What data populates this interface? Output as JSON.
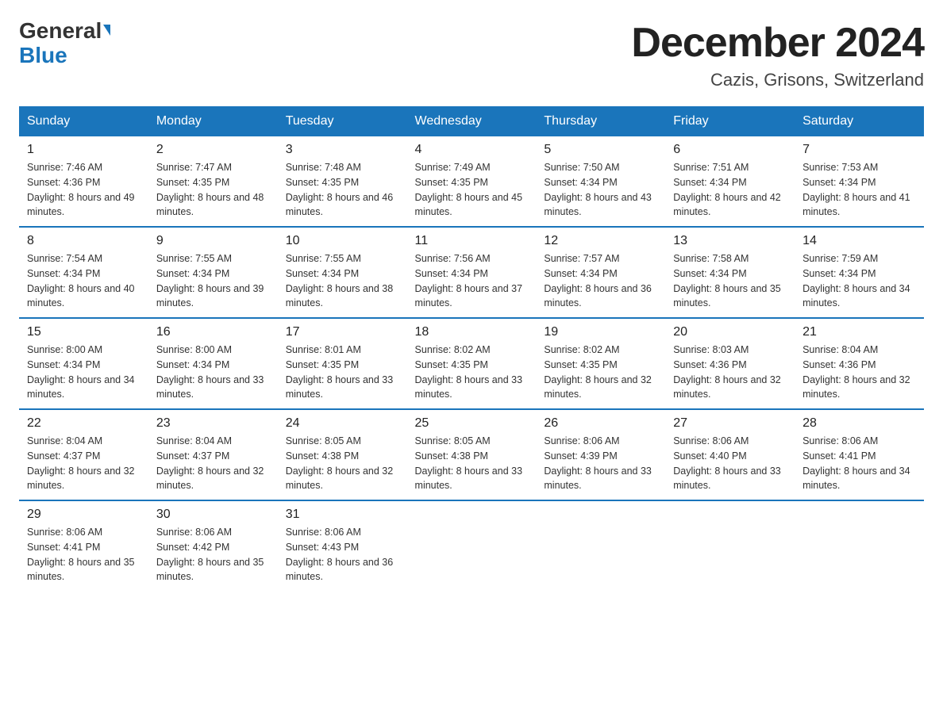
{
  "logo": {
    "general": "General",
    "blue": "Blue"
  },
  "header": {
    "month_year": "December 2024",
    "location": "Cazis, Grisons, Switzerland"
  },
  "days_of_week": [
    "Sunday",
    "Monday",
    "Tuesday",
    "Wednesday",
    "Thursday",
    "Friday",
    "Saturday"
  ],
  "weeks": [
    [
      {
        "day": "1",
        "sunrise": "7:46 AM",
        "sunset": "4:36 PM",
        "daylight": "8 hours and 49 minutes."
      },
      {
        "day": "2",
        "sunrise": "7:47 AM",
        "sunset": "4:35 PM",
        "daylight": "8 hours and 48 minutes."
      },
      {
        "day": "3",
        "sunrise": "7:48 AM",
        "sunset": "4:35 PM",
        "daylight": "8 hours and 46 minutes."
      },
      {
        "day": "4",
        "sunrise": "7:49 AM",
        "sunset": "4:35 PM",
        "daylight": "8 hours and 45 minutes."
      },
      {
        "day": "5",
        "sunrise": "7:50 AM",
        "sunset": "4:34 PM",
        "daylight": "8 hours and 43 minutes."
      },
      {
        "day": "6",
        "sunrise": "7:51 AM",
        "sunset": "4:34 PM",
        "daylight": "8 hours and 42 minutes."
      },
      {
        "day": "7",
        "sunrise": "7:53 AM",
        "sunset": "4:34 PM",
        "daylight": "8 hours and 41 minutes."
      }
    ],
    [
      {
        "day": "8",
        "sunrise": "7:54 AM",
        "sunset": "4:34 PM",
        "daylight": "8 hours and 40 minutes."
      },
      {
        "day": "9",
        "sunrise": "7:55 AM",
        "sunset": "4:34 PM",
        "daylight": "8 hours and 39 minutes."
      },
      {
        "day": "10",
        "sunrise": "7:55 AM",
        "sunset": "4:34 PM",
        "daylight": "8 hours and 38 minutes."
      },
      {
        "day": "11",
        "sunrise": "7:56 AM",
        "sunset": "4:34 PM",
        "daylight": "8 hours and 37 minutes."
      },
      {
        "day": "12",
        "sunrise": "7:57 AM",
        "sunset": "4:34 PM",
        "daylight": "8 hours and 36 minutes."
      },
      {
        "day": "13",
        "sunrise": "7:58 AM",
        "sunset": "4:34 PM",
        "daylight": "8 hours and 35 minutes."
      },
      {
        "day": "14",
        "sunrise": "7:59 AM",
        "sunset": "4:34 PM",
        "daylight": "8 hours and 34 minutes."
      }
    ],
    [
      {
        "day": "15",
        "sunrise": "8:00 AM",
        "sunset": "4:34 PM",
        "daylight": "8 hours and 34 minutes."
      },
      {
        "day": "16",
        "sunrise": "8:00 AM",
        "sunset": "4:34 PM",
        "daylight": "8 hours and 33 minutes."
      },
      {
        "day": "17",
        "sunrise": "8:01 AM",
        "sunset": "4:35 PM",
        "daylight": "8 hours and 33 minutes."
      },
      {
        "day": "18",
        "sunrise": "8:02 AM",
        "sunset": "4:35 PM",
        "daylight": "8 hours and 33 minutes."
      },
      {
        "day": "19",
        "sunrise": "8:02 AM",
        "sunset": "4:35 PM",
        "daylight": "8 hours and 32 minutes."
      },
      {
        "day": "20",
        "sunrise": "8:03 AM",
        "sunset": "4:36 PM",
        "daylight": "8 hours and 32 minutes."
      },
      {
        "day": "21",
        "sunrise": "8:04 AM",
        "sunset": "4:36 PM",
        "daylight": "8 hours and 32 minutes."
      }
    ],
    [
      {
        "day": "22",
        "sunrise": "8:04 AM",
        "sunset": "4:37 PM",
        "daylight": "8 hours and 32 minutes."
      },
      {
        "day": "23",
        "sunrise": "8:04 AM",
        "sunset": "4:37 PM",
        "daylight": "8 hours and 32 minutes."
      },
      {
        "day": "24",
        "sunrise": "8:05 AM",
        "sunset": "4:38 PM",
        "daylight": "8 hours and 32 minutes."
      },
      {
        "day": "25",
        "sunrise": "8:05 AM",
        "sunset": "4:38 PM",
        "daylight": "8 hours and 33 minutes."
      },
      {
        "day": "26",
        "sunrise": "8:06 AM",
        "sunset": "4:39 PM",
        "daylight": "8 hours and 33 minutes."
      },
      {
        "day": "27",
        "sunrise": "8:06 AM",
        "sunset": "4:40 PM",
        "daylight": "8 hours and 33 minutes."
      },
      {
        "day": "28",
        "sunrise": "8:06 AM",
        "sunset": "4:41 PM",
        "daylight": "8 hours and 34 minutes."
      }
    ],
    [
      {
        "day": "29",
        "sunrise": "8:06 AM",
        "sunset": "4:41 PM",
        "daylight": "8 hours and 35 minutes."
      },
      {
        "day": "30",
        "sunrise": "8:06 AM",
        "sunset": "4:42 PM",
        "daylight": "8 hours and 35 minutes."
      },
      {
        "day": "31",
        "sunrise": "8:06 AM",
        "sunset": "4:43 PM",
        "daylight": "8 hours and 36 minutes."
      },
      null,
      null,
      null,
      null
    ]
  ]
}
